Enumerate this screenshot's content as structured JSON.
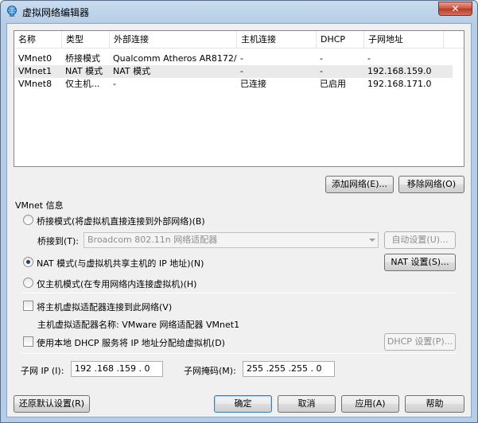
{
  "window": {
    "title": "虚拟网络编辑器",
    "close_label": "✕"
  },
  "list": {
    "columns": [
      "名称",
      "类型",
      "外部连接",
      "主机连接",
      "DHCP",
      "子网地址"
    ],
    "rows": [
      [
        "VMnet0",
        "桥接模式",
        "Qualcomm Atheros AR8172/...",
        "-",
        "-",
        "-"
      ],
      [
        "VMnet1",
        "NAT 模式",
        "NAT 模式",
        "-",
        "-",
        "192.168.159.0"
      ],
      [
        "VMnet8",
        "仅主机...",
        "-",
        "已连接",
        "已启用",
        "192.168.171.0"
      ]
    ]
  },
  "buttons": {
    "add_network": "添加网络(E)...",
    "remove_network": "移除网络(O)",
    "auto_settings": "自动设置(U)...",
    "nat_settings": "NAT 设置(S)...",
    "dhcp_settings": "DHCP 设置(P)...",
    "restore_defaults": "还原默认设置(R)",
    "ok": "确定",
    "cancel": "取消",
    "apply": "应用(A)",
    "help": "帮助"
  },
  "vmnet_info": {
    "group_title": "VMnet 信息",
    "bridged_label": "桥接模式(将虚拟机直接连接到外部网络)(B)",
    "bridge_to_label": "桥接到(T):",
    "bridge_to_value": "Broadcom 802.11n 网络适配器",
    "nat_label": "NAT 模式(与虚拟机共享主机的 IP 地址)(N)",
    "hostonly_label": "仅主机模式(在专用网络内连接虚拟机)(H)",
    "selected_mode": "nat",
    "connect_adapter_label": "将主机虚拟适配器连接到此网络(V)",
    "adapter_name_label": "主机虚拟适配器名称: VMware 网络适配器 VMnet1",
    "dhcp_label": "使用本地 DHCP 服务将 IP 地址分配给虚拟机(D)",
    "subnet_ip_label": "子网 IP (I):",
    "subnet_ip_value": "192 .168 .159 . 0",
    "subnet_mask_label": "子网掩码(M):",
    "subnet_mask_value": "255 .255 .255 . 0"
  }
}
